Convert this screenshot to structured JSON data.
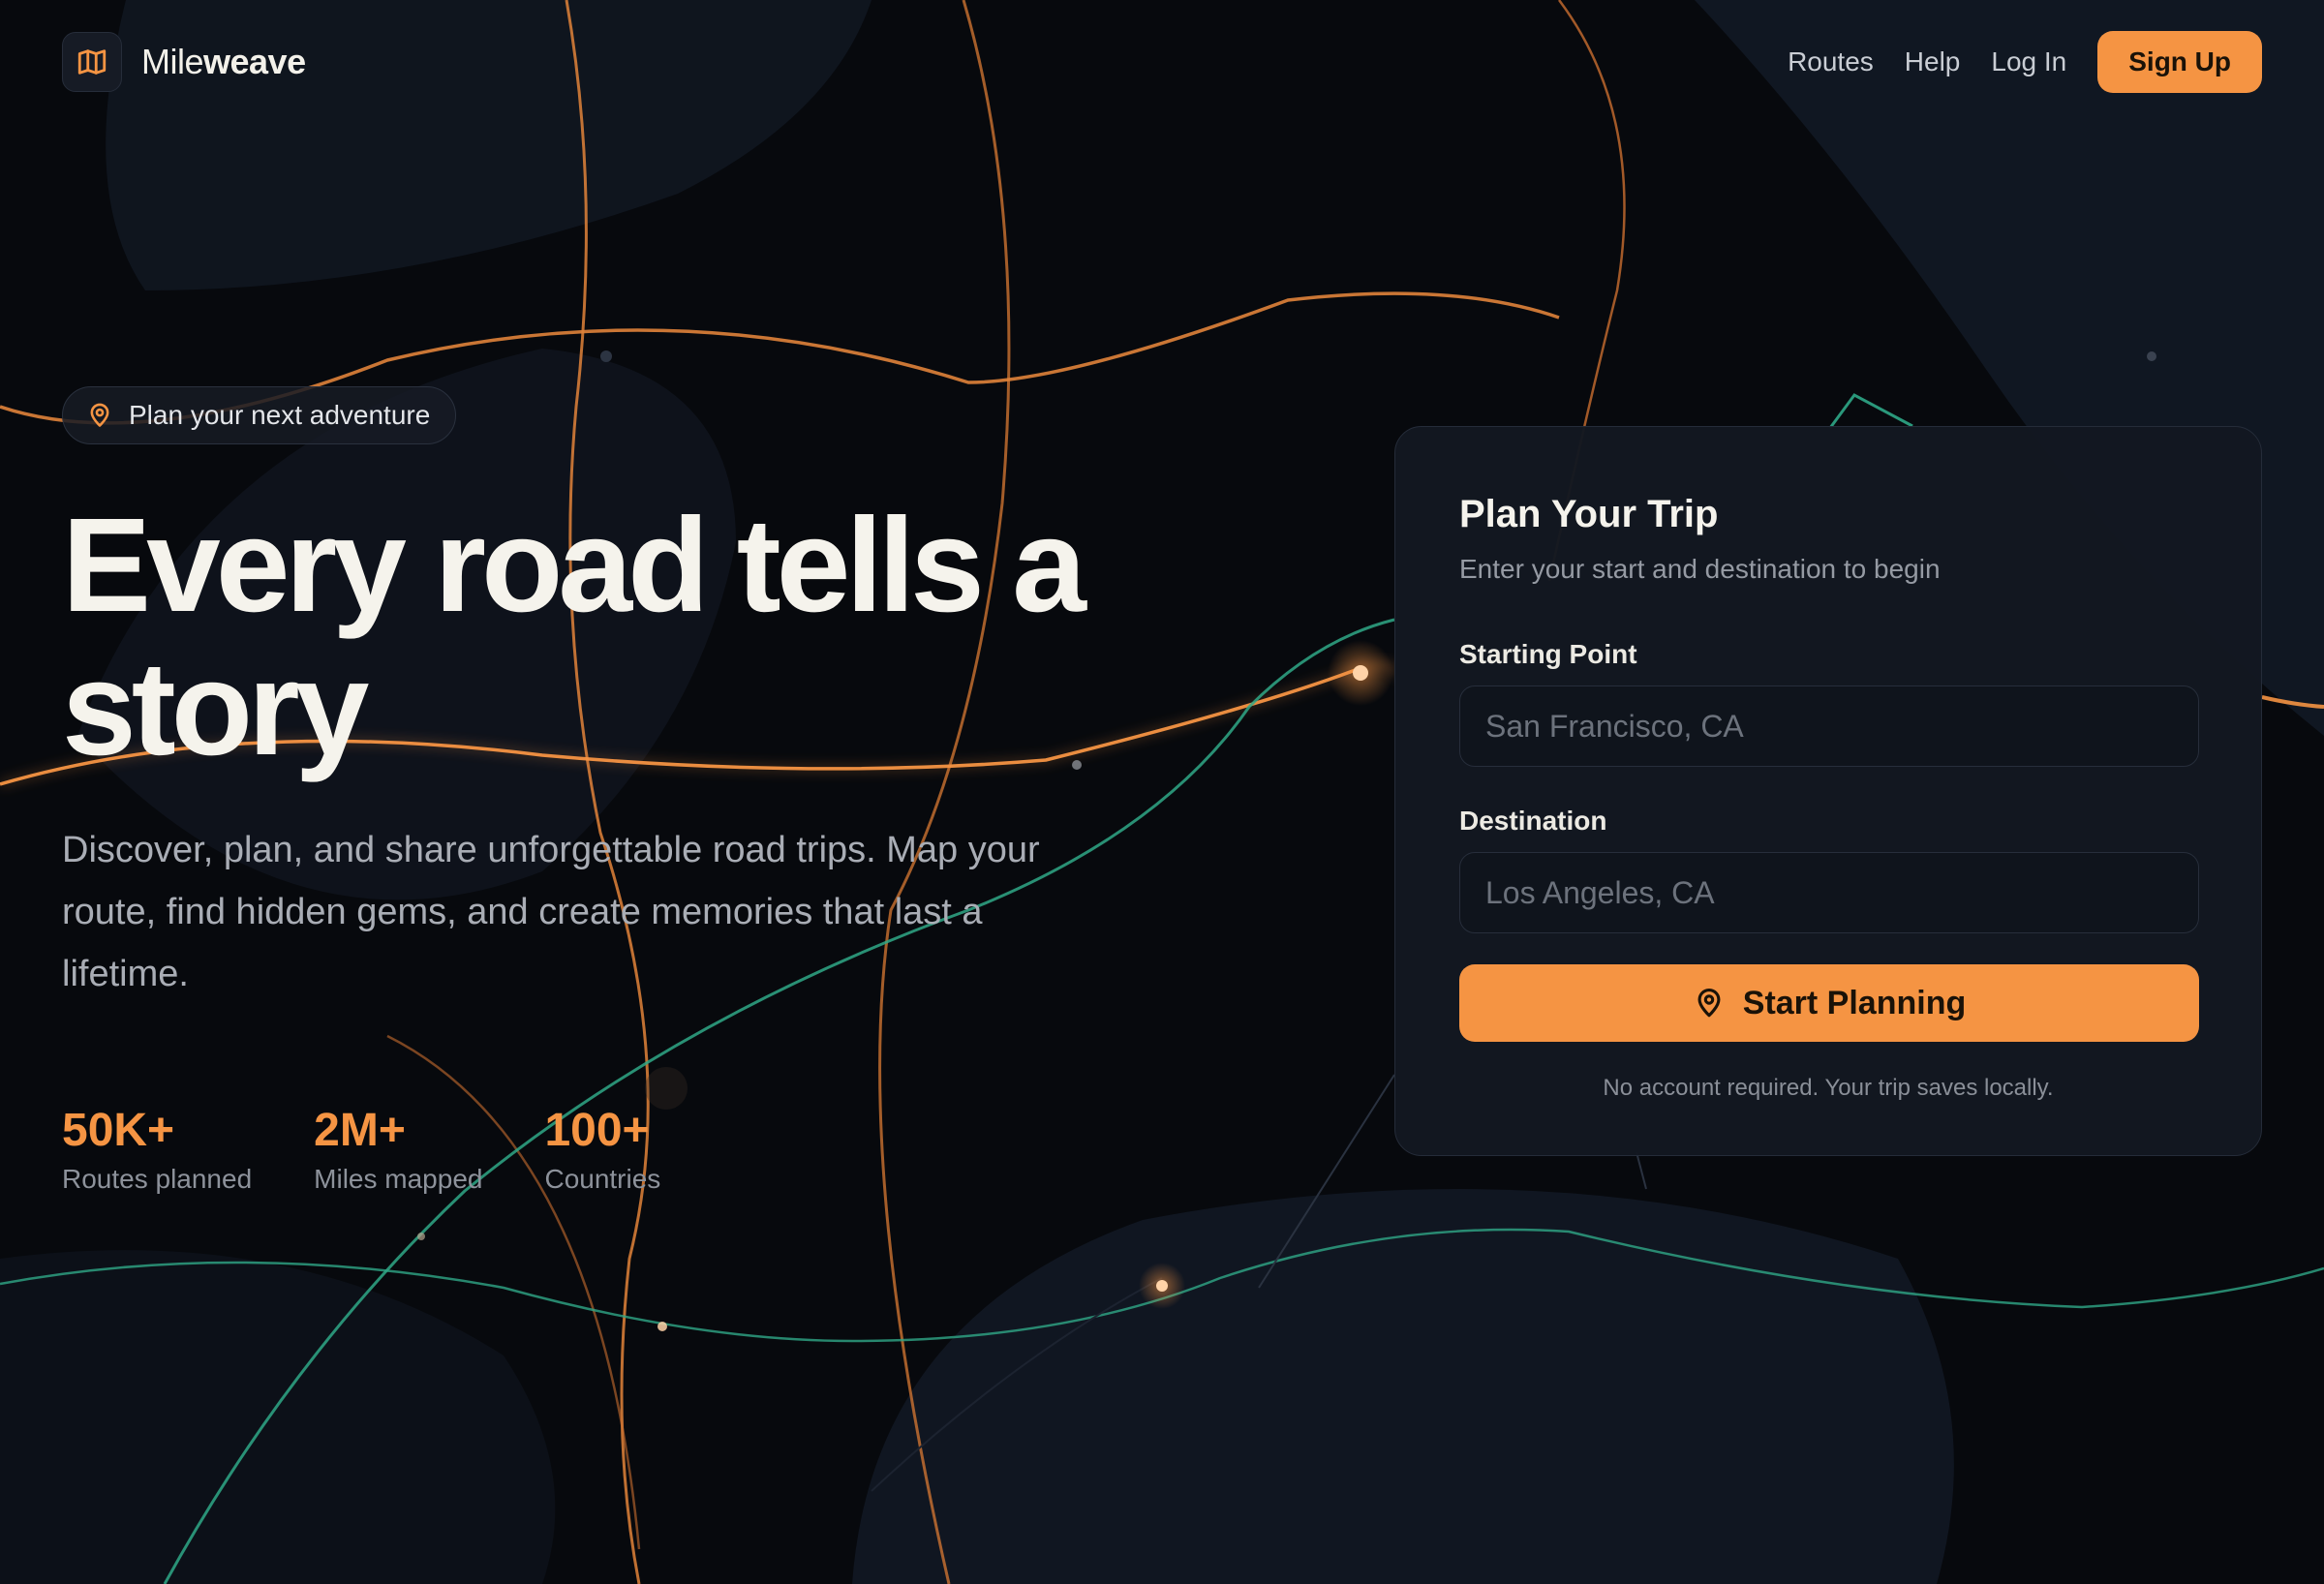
{
  "brand": {
    "prefix": "Mile",
    "suffix": "weave",
    "icon": "map-icon"
  },
  "nav": {
    "links": [
      "Routes",
      "Help",
      "Log In"
    ],
    "cta": "Sign Up"
  },
  "badge": {
    "icon": "map-pin-icon",
    "text": "Plan your next adventure"
  },
  "hero": {
    "title": "Every road tells a story",
    "description": "Discover, plan, and share unforgettable road trips. Map your route, find hidden gems, and create memories that last a lifetime."
  },
  "stats": [
    {
      "value": "50K+",
      "label": "Routes planned"
    },
    {
      "value": "2M+",
      "label": "Miles mapped"
    },
    {
      "value": "100+",
      "label": "Countries"
    }
  ],
  "trip_form": {
    "title": "Plan Your Trip",
    "subtitle": "Enter your start and destination to begin",
    "start_label": "Starting Point",
    "start_placeholder": "San Francisco, CA",
    "start_value": "",
    "dest_label": "Destination",
    "dest_placeholder": "Los Angeles, CA",
    "dest_value": "",
    "submit_label": "Start Planning",
    "submit_icon": "map-pin-icon",
    "note": "No account required. Your trip saves locally."
  },
  "colors": {
    "accent": "#f59443",
    "route_green": "#2fa887",
    "background": "#07090d"
  }
}
